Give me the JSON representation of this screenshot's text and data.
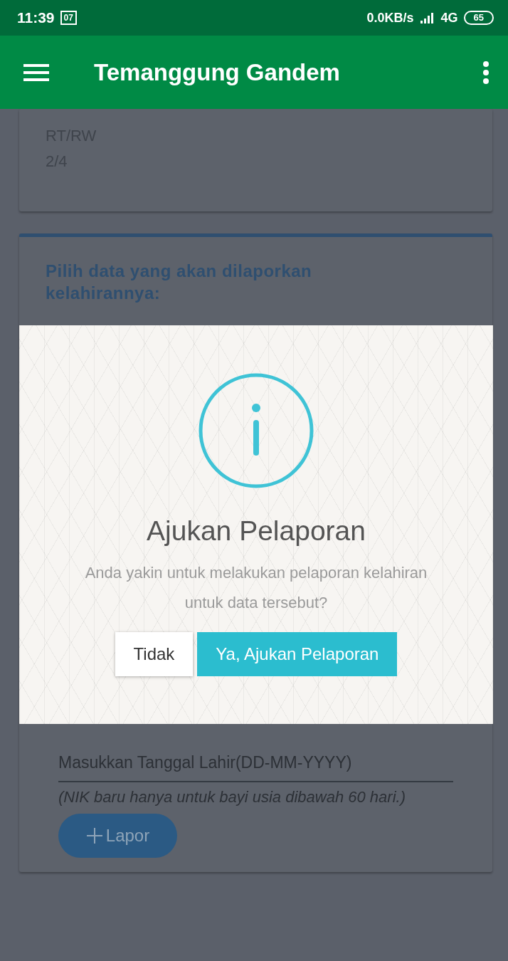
{
  "status_bar": {
    "time": "11:39",
    "calendar_badge": "07",
    "network_speed": "0.0KB/s",
    "network_type": "4G",
    "battery": "65"
  },
  "app_bar": {
    "title": "Temanggung Gandem"
  },
  "info_card": {
    "label": "RT/RW",
    "value": "2/4"
  },
  "report_card": {
    "heading": "Pilih data yang akan dilaporkan kelahirannya:",
    "date_field": {
      "placeholder": "Masukkan Tanggal Lahir(DD-MM-YYYY)"
    },
    "note": "(NIK baru hanya untuk bayi usia dibawah 60 hari.)",
    "submit_button": "Lapor"
  },
  "dialog": {
    "title": "Ajukan Pelaporan",
    "message": "Anda yakin untuk melakukan pelaporan kelahiran untuk data tersebut?",
    "buttons": [
      {
        "label": "Tidak",
        "kind": "cancel"
      },
      {
        "label": "Ya, Ajukan Pelaporan",
        "kind": "confirm"
      }
    ]
  }
}
